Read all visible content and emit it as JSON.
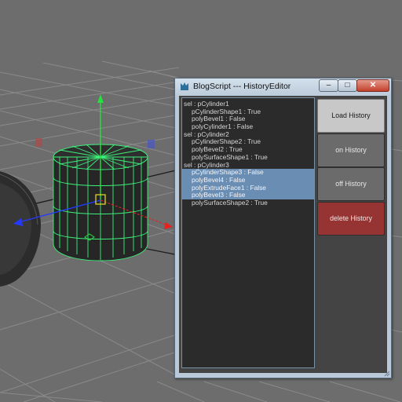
{
  "window": {
    "title": "BlogScript --- HistoryEditor",
    "minimize_glyph": "–",
    "maximize_glyph": "□",
    "close_glyph": "✕"
  },
  "history_list": [
    {
      "text": "sel : pCylinder1",
      "indent": false,
      "selected": false
    },
    {
      "text": "pCylinderShape1 : True",
      "indent": true,
      "selected": false
    },
    {
      "text": "polyBevel1 : False",
      "indent": true,
      "selected": false
    },
    {
      "text": "polyCylinder1 : False",
      "indent": true,
      "selected": false
    },
    {
      "text": "sel : pCylinder2",
      "indent": false,
      "selected": false
    },
    {
      "text": "pCylinderShape2 : True",
      "indent": true,
      "selected": false
    },
    {
      "text": "polyBevel2 : True",
      "indent": true,
      "selected": false
    },
    {
      "text": "polySurfaceShape1 : True",
      "indent": true,
      "selected": false
    },
    {
      "text": "sel : pCylinder3",
      "indent": false,
      "selected": false
    },
    {
      "text": "pCylinderShape3 : False",
      "indent": true,
      "selected": true
    },
    {
      "text": "polyBevel4 : False",
      "indent": true,
      "selected": true
    },
    {
      "text": "polyExtrudeFace1 : False",
      "indent": true,
      "selected": true
    },
    {
      "text": "polyBevel3 : False",
      "indent": true,
      "selected": true
    },
    {
      "text": "polySurfaceShape2 : True",
      "indent": true,
      "selected": false
    }
  ],
  "buttons": {
    "load_label": "Load History",
    "on_label": "on  History",
    "off_label": "off History",
    "delete_label": "delete History"
  },
  "colors": {
    "viewport_bg": "#6d6d6d",
    "grid_line": "#8a8a8a",
    "wireframe": "#3cf27a",
    "selection_highlight": "#6a8db4",
    "delete_button": "#963434"
  },
  "icons": {
    "title": "maya-window-icon",
    "resize": "resize-grip-icon"
  }
}
